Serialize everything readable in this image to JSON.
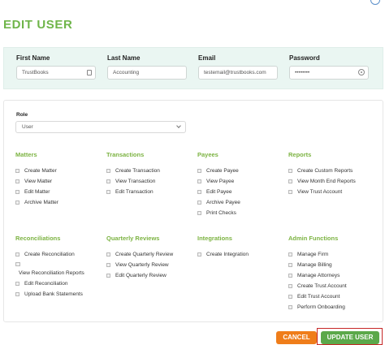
{
  "page": {
    "title": "EDIT USER"
  },
  "user_fields": [
    {
      "label": "First Name",
      "value": "TrustBooks"
    },
    {
      "label": "Last Name",
      "value": "Accounting"
    },
    {
      "label": "Email",
      "value": "testemail@trustbooks.com"
    },
    {
      "label": "Password",
      "value": "••••••••"
    }
  ],
  "role": {
    "label": "Role",
    "selected": "User"
  },
  "sections": [
    {
      "title": "Matters",
      "items": [
        "Create Matter",
        "View Matter",
        "Edit Matter",
        "Archive Matter"
      ]
    },
    {
      "title": "Transactions",
      "items": [
        "Create Transaction",
        "View Transaction",
        "Edit Transaction"
      ]
    },
    {
      "title": "Payees",
      "items": [
        "Create Payee",
        "View Payee",
        "Edit Payee",
        "Archive Payee",
        "Print Checks"
      ]
    },
    {
      "title": "Reports",
      "items": [
        "Create Custom Reports",
        "View Month End Reports",
        "View Trust Account"
      ]
    },
    {
      "title": "Reconciliations",
      "items": [
        "Create Reconciliation",
        "View Reconciliation Reports",
        "Edit Reconciliation",
        "Upload Bank Statements"
      ]
    },
    {
      "title": "Quarterly Reviews",
      "items": [
        "Create Quarterly Review",
        "View Quarterly Review",
        "Edit Quarterly Review"
      ]
    },
    {
      "title": "Integrations",
      "items": [
        "Create Integration"
      ]
    },
    {
      "title": "Admin Functions",
      "items": [
        "Manage Firm",
        "Manage Billing",
        "Manage Attorneys",
        "Create Trust Account",
        "Edit Trust Account",
        "Perform Onboarding"
      ]
    }
  ],
  "buttons": {
    "cancel": "CANCEL",
    "update": "UPDATE USER"
  },
  "colors": {
    "title_green": "#6fb54a",
    "section_green": "#7cb342",
    "cancel_orange": "#ef7d1a",
    "update_green": "#5ba84a",
    "highlight_red": "#c62828",
    "panel_bg": "#eaf6f2"
  },
  "icons": {
    "top_right": "refresh-icon",
    "first_name": "contact-card-icon",
    "password": "eye-icon",
    "role": "chevron-down-icon"
  }
}
